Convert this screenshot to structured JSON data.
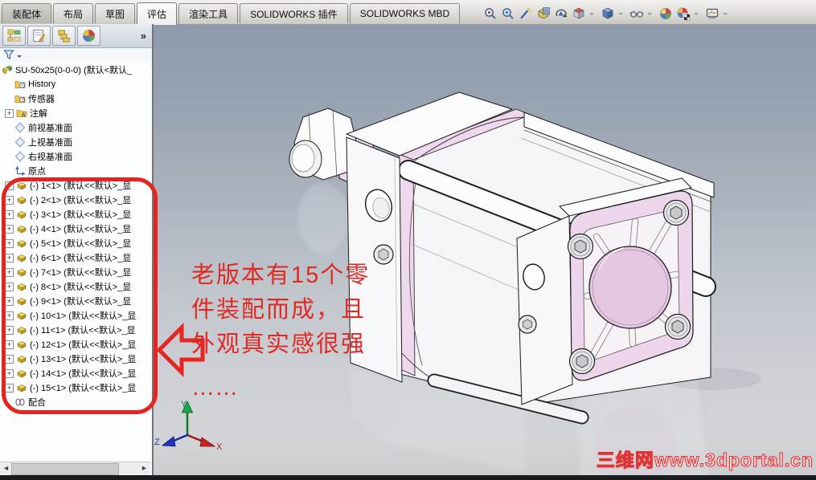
{
  "app": {
    "name": "SOLIDWORKS assembly view"
  },
  "colors": {
    "accent_pink": "#EDD5EB",
    "annotation_red": "#E42420",
    "background_top": "#8E9AAB",
    "background_bottom": "#CCCDD1",
    "model_body": "#FAFAFB"
  },
  "tabs": {
    "items": [
      {
        "label": "装配体",
        "state": "pressed"
      },
      {
        "label": "布局",
        "state": "normal"
      },
      {
        "label": "草图",
        "state": "normal"
      },
      {
        "label": "评估",
        "state": "active"
      },
      {
        "label": "渲染工具",
        "state": "normal"
      },
      {
        "label": "SOLIDWORKS 插件",
        "state": "normal"
      },
      {
        "label": "SOLIDWORKS MBD",
        "state": "normal"
      }
    ]
  },
  "headsup": {
    "icons": [
      {
        "name": "zoom-fit",
        "dropdown": false
      },
      {
        "name": "zoom-area",
        "dropdown": false
      },
      {
        "name": "zoom-to-selection",
        "dropdown": false
      },
      {
        "name": "section-view",
        "dropdown": false
      },
      {
        "name": "rotate-view",
        "dropdown": false
      },
      {
        "name": "view-orientation",
        "dropdown": true
      },
      {
        "name": "display-style",
        "dropdown": true
      },
      {
        "name": "hide-show-items",
        "dropdown": true
      },
      {
        "name": "edit-appearance",
        "dropdown": false
      },
      {
        "name": "apply-scene",
        "dropdown": true
      },
      {
        "name": "view-settings",
        "dropdown": true
      }
    ]
  },
  "panel": {
    "header_icons": [
      "featuremanager",
      "propertymanager",
      "configurationmanager",
      "displaymanager"
    ],
    "more_label": "»",
    "filter_icon": "filter-funnel",
    "tree": {
      "rows": [
        {
          "icon": "assembly",
          "label": "SU-50x25(0-0-0) (默认<默认_",
          "indent": 0,
          "expand": ""
        },
        {
          "icon": "history",
          "label": "History",
          "indent": 1,
          "expand": ""
        },
        {
          "icon": "sensors",
          "label": "传感器",
          "indent": 1,
          "expand": ""
        },
        {
          "icon": "annotations",
          "label": "注解",
          "indent": 1,
          "expand": "+"
        },
        {
          "icon": "plane",
          "label": "前视基准面",
          "indent": 1,
          "expand": ""
        },
        {
          "icon": "plane",
          "label": "上视基准面",
          "indent": 1,
          "expand": ""
        },
        {
          "icon": "plane",
          "label": "右视基准面",
          "indent": 1,
          "expand": ""
        },
        {
          "icon": "origin",
          "label": "原点",
          "indent": 1,
          "expand": ""
        },
        {
          "icon": "part",
          "label": "(-) 1<1> (默认<<默认>_显",
          "indent": 1,
          "expand": "+"
        },
        {
          "icon": "part",
          "label": "(-) 2<1> (默认<<默认>_显",
          "indent": 1,
          "expand": "+"
        },
        {
          "icon": "part",
          "label": "(-) 3<1> (默认<<默认>_显",
          "indent": 1,
          "expand": "+"
        },
        {
          "icon": "part",
          "label": "(-) 4<1> (默认<<默认>_显",
          "indent": 1,
          "expand": "+"
        },
        {
          "icon": "part",
          "label": "(-) 5<1> (默认<<默认>_显",
          "indent": 1,
          "expand": "+"
        },
        {
          "icon": "part",
          "label": "(-) 6<1> (默认<<默认>_显",
          "indent": 1,
          "expand": "+"
        },
        {
          "icon": "part",
          "label": "(-) 7<1> (默认<<默认>_显",
          "indent": 1,
          "expand": "+"
        },
        {
          "icon": "part",
          "label": "(-) 8<1> (默认<<默认>_显",
          "indent": 1,
          "expand": "+"
        },
        {
          "icon": "part",
          "label": "(-) 9<1> (默认<<默认>_显",
          "indent": 1,
          "expand": "+"
        },
        {
          "icon": "part",
          "label": "(-) 10<1> (默认<<默认>_显",
          "indent": 1,
          "expand": "+"
        },
        {
          "icon": "part",
          "label": "(-) 11<1> (默认<<默认>_显",
          "indent": 1,
          "expand": "+"
        },
        {
          "icon": "part",
          "label": "(-) 12<1> (默认<<默认>_显",
          "indent": 1,
          "expand": "+"
        },
        {
          "icon": "part",
          "label": "(-) 13<1> (默认<<默认>_显",
          "indent": 1,
          "expand": "+"
        },
        {
          "icon": "part",
          "label": "(-) 14<1> (默认<<默认>_显",
          "indent": 1,
          "expand": "+"
        },
        {
          "icon": "part",
          "label": "(-) 15<1> (默认<<默认>_显",
          "indent": 1,
          "expand": "+"
        },
        {
          "icon": "mates",
          "label": "配合",
          "indent": 1,
          "expand": ""
        }
      ]
    }
  },
  "annotation": {
    "lines": [
      "老版本有15个零",
      "件装配而成，且",
      "外观真实感很强",
      "……"
    ]
  },
  "triad": {
    "x": "X",
    "y": "Y",
    "z": "Z"
  },
  "watermark": {
    "text": "三维网www.3dportal.cn"
  }
}
